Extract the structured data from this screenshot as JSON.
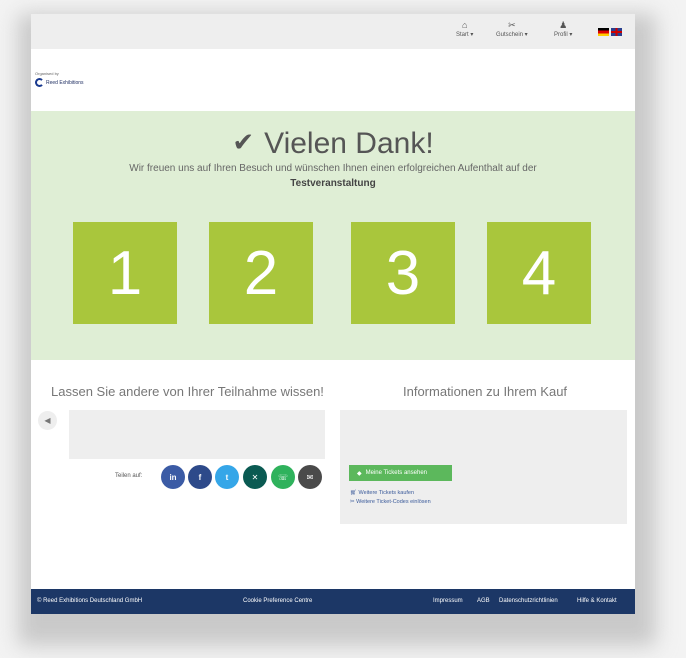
{
  "nav": {
    "start": "Start ▾",
    "voucher": "Gutschein ▾",
    "profile": "Profil ▾",
    "icons": [
      "home-icon",
      "ticket-icon",
      "user-icon"
    ],
    "languages": [
      "de-flag",
      "en-flag"
    ]
  },
  "organizer": {
    "label": "Organised by",
    "name": "Reed Exhibitions"
  },
  "hero": {
    "check_icon": "✔",
    "title": "Vielen Dank!",
    "text": "Wir freuen uns auf Ihren Besuch und wünschen Ihnen einen erfolgreichen Aufenthalt auf der",
    "event": "Testveranstaltung",
    "steps": [
      "1",
      "2",
      "3",
      "4"
    ],
    "background": "#dfeed5",
    "box_color": "#a9c63c"
  },
  "share": {
    "title": "Lassen Sie andere von Ihrer Teilnahme wissen!",
    "label": "Teilen auf:",
    "networks": [
      {
        "name": "linkedin",
        "glyph": "in",
        "color": "#3b5ba5"
      },
      {
        "name": "facebook",
        "glyph": "f",
        "color": "#2d4a8a"
      },
      {
        "name": "twitter",
        "glyph": "t",
        "color": "#35a6e8"
      },
      {
        "name": "xing",
        "glyph": "x",
        "color": "#0a5a52"
      },
      {
        "name": "whatsapp",
        "glyph": "w",
        "color": "#2fb25c"
      },
      {
        "name": "email",
        "glyph": "✉",
        "color": "#4a4a4a"
      }
    ]
  },
  "purchase": {
    "title": "Informationen zu Ihrem Kauf",
    "button": "Meine Tickets ansehen",
    "links": [
      "Weitere Tickets kaufen",
      "Weitere Ticket-Codes einlösen"
    ]
  },
  "footer": {
    "company": "© Reed Exhibitions Deutschland GmbH",
    "cookie": "Cookie Preference Centre",
    "links": [
      "Impressum",
      "AGB",
      "Datenschutzrichtlinien",
      "Hilfe & Kontakt"
    ],
    "color": "#1c3766"
  }
}
